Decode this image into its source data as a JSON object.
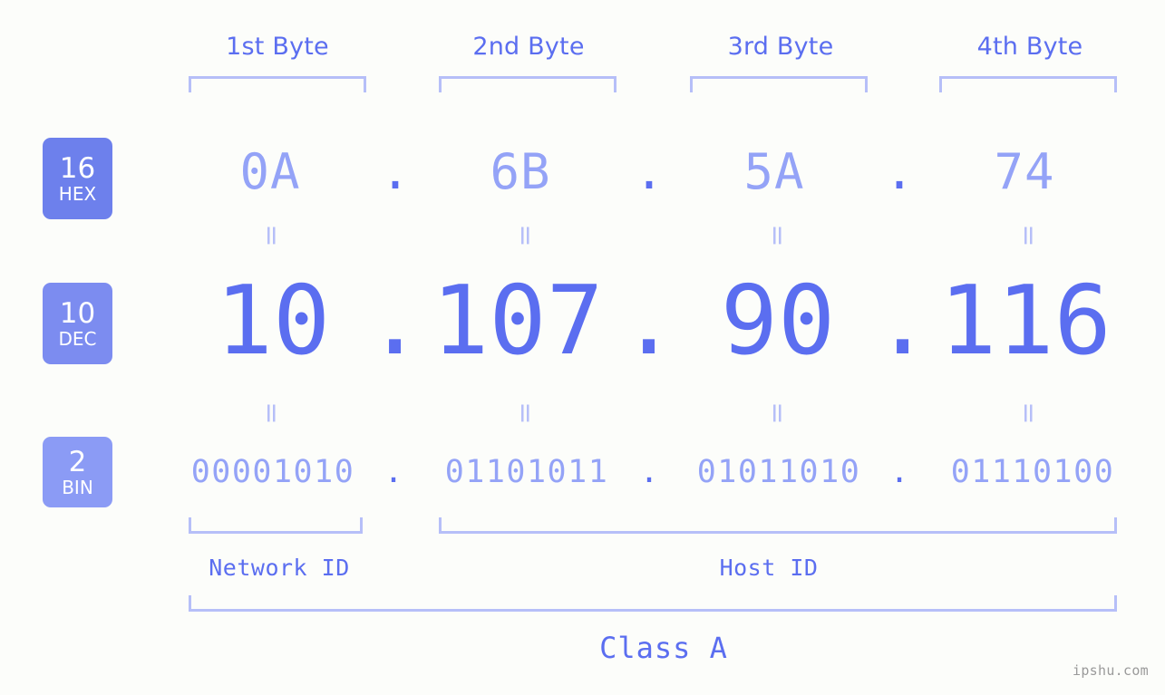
{
  "background": "#fcfdfa",
  "colors": {
    "strong_blue": "#5b6ef0",
    "light_blue": "#94a3f7",
    "bracket": "#b6bff8",
    "badge_hex": "#6d80ec",
    "badge_dec": "#7c8cf0",
    "badge_bin": "#8b9bf5",
    "watermark": "#9a9a9a"
  },
  "byte_headers": [
    {
      "label": "1st Byte"
    },
    {
      "label": "2nd Byte"
    },
    {
      "label": "3rd Byte"
    },
    {
      "label": "4th Byte"
    }
  ],
  "bases": [
    {
      "number": "16",
      "name": "HEX"
    },
    {
      "number": "10",
      "name": "DEC"
    },
    {
      "number": "2",
      "name": "BIN"
    }
  ],
  "separator": ".",
  "equals_glyph": "=",
  "rows": {
    "hex": {
      "values": [
        "0A",
        "6B",
        "5A",
        "74"
      ]
    },
    "dec": {
      "values": [
        "10",
        "107",
        "90",
        "116"
      ]
    },
    "bin": {
      "values": [
        "00001010",
        "01101011",
        "01011010",
        "01110100"
      ]
    }
  },
  "segments": {
    "network_id": "Network ID",
    "host_id": "Host ID"
  },
  "class": "Class A",
  "watermark": "ipshu.com"
}
